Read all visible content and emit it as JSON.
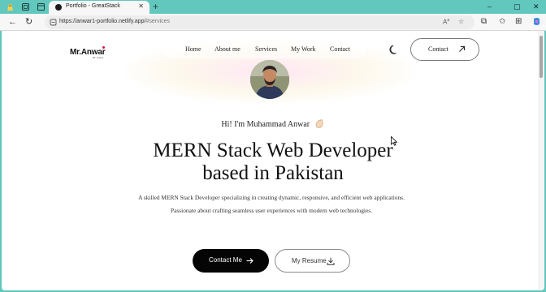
{
  "browser": {
    "tab_title": "Portfolio - GreatStack",
    "url_host": "https://anwar1-portfolio.netlify.app/",
    "url_path": "#services",
    "window_controls": [
      "–",
      "▢",
      "✕"
    ]
  },
  "site": {
    "logo": "Mr.Anwar",
    "logo_sub": "Mr. Anwar",
    "nav": [
      "Home",
      "About me",
      "Services",
      "My Work",
      "Contact"
    ],
    "contact_button": "Contact"
  },
  "hero": {
    "greeting": "Hi! I'm Muhammad Anwar",
    "headline_line1": "MERN Stack Web Developer",
    "headline_line2": "based in Pakistan",
    "description": "A skilled MERN Stack Developer specializing in creating dynamic, responsive, and efficient web applications. Passionate about crafting seamless user experiences with modern web technologies.",
    "primary_cta": "Contact Me",
    "secondary_cta": "My Resume"
  },
  "icons": {
    "greeting": "waving-hand-icon",
    "primary_cta": "arrow-right-icon",
    "secondary_cta": "download-icon",
    "contact": "arrow-up-right-icon",
    "theme": "moon-icon"
  },
  "colors": {
    "browser_frame": "#62c7bd",
    "primary_button": "#050505",
    "page_background": "#ffffff"
  }
}
